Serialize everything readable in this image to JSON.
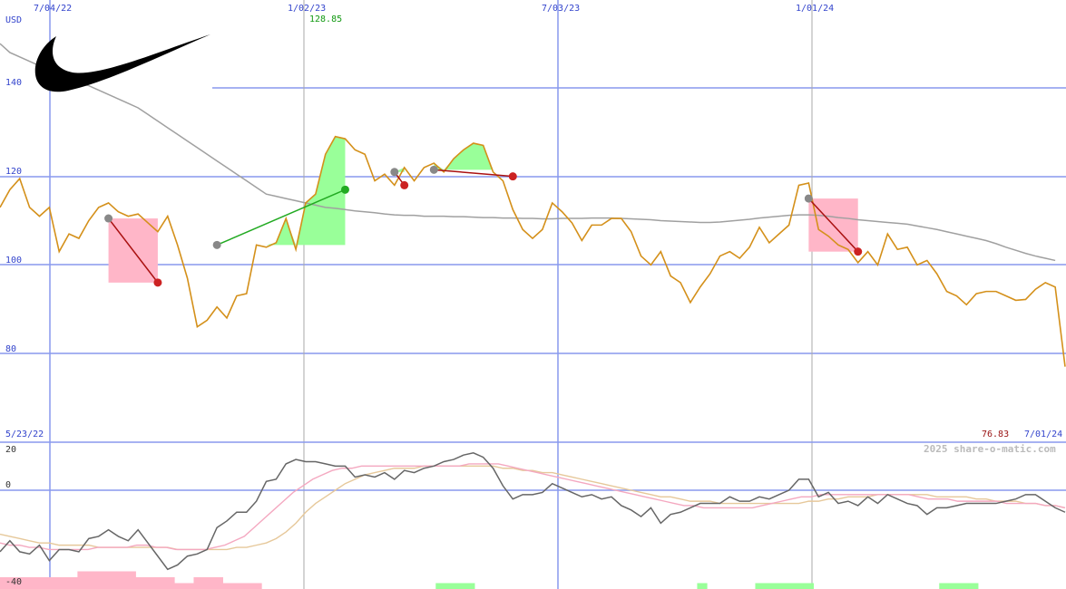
{
  "chart_data": {
    "type": "line",
    "currency_label": "USD",
    "date_ticks": [
      "7/04/22",
      "1/02/23",
      "7/03/23",
      "1/01/24"
    ],
    "start_date_label": "5/23/22",
    "end_date_label": "7/01/24",
    "high_label": "128.85",
    "last_label": "76.83",
    "watermark": "2025 share-o-matic.com",
    "price_ticks": [
      80,
      100,
      120,
      140
    ],
    "ylim": [
      68,
      155
    ],
    "oscillator_ticks": [
      "20",
      "0",
      "-40"
    ],
    "oscillator_ylim": [
      -40,
      25
    ],
    "price_series": {
      "name": "",
      "values": [
        113,
        117,
        119.5,
        113,
        111,
        113,
        103,
        107,
        106,
        110,
        113,
        114,
        112,
        111,
        111.5,
        109.5,
        107.5,
        111,
        104.5,
        97,
        86,
        87.5,
        90.5,
        88,
        93,
        93.5,
        104.5,
        104,
        105,
        110.5,
        103.5,
        114,
        116,
        125,
        129,
        128.5,
        126,
        125,
        119,
        120.5,
        118,
        122,
        119,
        122,
        123,
        121,
        124,
        126,
        127.5,
        127,
        121,
        119,
        112.5,
        108,
        106,
        108,
        114,
        112,
        109.5,
        105.5,
        109,
        109,
        110.5,
        110.5,
        107.5,
        102,
        100,
        103,
        97.5,
        96,
        91.5,
        95,
        98,
        102,
        103,
        101.5,
        104,
        108.5,
        105,
        107,
        109,
        118,
        118.5,
        108,
        106.5,
        104.5,
        103.5,
        100.5,
        103,
        100,
        107,
        103.5,
        104,
        100,
        101,
        98,
        94,
        93,
        91,
        93.5,
        94,
        94,
        93,
        92,
        92.2,
        94.5,
        96,
        95,
        77
      ]
    },
    "moving_average": {
      "name": "",
      "values": [
        150,
        148,
        147,
        146,
        145,
        144,
        143,
        142,
        141,
        140.5,
        139.5,
        138.5,
        137.5,
        136.5,
        135.5,
        134,
        132.5,
        131,
        129.5,
        128,
        126.5,
        125,
        123.5,
        122,
        120.5,
        119,
        117.5,
        116,
        115.5,
        115,
        114.5,
        114,
        113.5,
        113,
        112.8,
        112.5,
        112.2,
        112,
        111.8,
        111.5,
        111.3,
        111.2,
        111.2,
        111,
        111,
        111,
        110.9,
        110.9,
        110.8,
        110.7,
        110.7,
        110.6,
        110.6,
        110.5,
        110.5,
        110.4,
        110.4,
        110.5,
        110.5,
        110.5,
        110.6,
        110.6,
        110.6,
        110.5,
        110.4,
        110.3,
        110.2,
        110,
        109.9,
        109.8,
        109.7,
        109.6,
        109.6,
        109.7,
        109.9,
        110.1,
        110.3,
        110.6,
        110.8,
        111,
        111.2,
        111.3,
        111.3,
        111.2,
        111,
        110.7,
        110.5,
        110.2,
        110,
        109.8,
        109.6,
        109.4,
        109.2,
        108.8,
        108.4,
        108,
        107.5,
        107,
        106.5,
        106,
        105.5,
        104.8,
        104,
        103.3,
        102.6,
        102,
        101.5,
        101
      ]
    },
    "buy_signals": [
      {
        "buy_index": 22,
        "buy_value": 104.5,
        "sell_index": 35,
        "sell_value": 117
      },
      {
        "buy_index": 40,
        "buy_value": 121,
        "sell_index": 41,
        "sell_value": 118
      },
      {
        "buy_index": 44,
        "buy_value": 121.5,
        "sell_index": 52,
        "sell_value": 120
      }
    ],
    "sell_signals": [
      {
        "from_index": 11,
        "from_value": 110.5,
        "to_index": 16,
        "to_value": 96
      },
      {
        "from_index": 82,
        "from_value": 115,
        "to_index": 87,
        "to_value": 103
      }
    ],
    "oscillator_series": [
      {
        "name": "",
        "color": "#666666",
        "values": [
          -28,
          -23,
          -28,
          -29,
          -25,
          -32,
          -27,
          -27,
          -28,
          -22,
          -21,
          -18,
          -21,
          -23,
          -18,
          -24,
          -30,
          -36,
          -34,
          -30,
          -29,
          -27,
          -17,
          -14,
          -10,
          -10,
          -5,
          4,
          5,
          12,
          14,
          13,
          13,
          12,
          11,
          11,
          6,
          7,
          6,
          8,
          5,
          9,
          8,
          10,
          11,
          13,
          14,
          16,
          17,
          15,
          10,
          2,
          -4,
          -2,
          -2,
          -1,
          3,
          1,
          -1,
          -3,
          -2,
          -4,
          -3,
          -7,
          -9,
          -12,
          -8,
          -15,
          -11,
          -10,
          -8,
          -6,
          -6,
          -6,
          -3,
          -5,
          -5,
          -3,
          -4,
          -2,
          0,
          5,
          5,
          -3,
          -1,
          -6,
          -5,
          -7,
          -3,
          -6,
          -2,
          -4,
          -6,
          -7,
          -11,
          -8,
          -8,
          -7,
          -6,
          -6,
          -6,
          -6,
          -5,
          -4,
          -2,
          -2,
          -5,
          -8,
          -10
        ]
      },
      {
        "name": "",
        "color": "#f4a8c0",
        "values": [
          -24,
          -25,
          -25,
          -26,
          -26,
          -27,
          -27,
          -27,
          -27,
          -27,
          -26,
          -26,
          -26,
          -26,
          -25,
          -25,
          -26,
          -26,
          -27,
          -27,
          -27,
          -27,
          -26,
          -25,
          -23,
          -21,
          -17,
          -13,
          -9,
          -5,
          -1,
          2,
          5,
          7,
          9,
          10,
          10,
          11,
          11,
          11,
          11,
          11,
          11,
          11,
          11,
          11,
          11,
          11,
          12,
          12,
          12,
          12,
          11,
          10,
          9,
          8,
          7,
          6,
          5,
          4,
          3,
          2,
          1,
          0,
          -1,
          -2,
          -3,
          -4,
          -5,
          -6,
          -7,
          -7,
          -8,
          -8,
          -8,
          -8,
          -8,
          -8,
          -7,
          -6,
          -5,
          -4,
          -3,
          -3,
          -2,
          -2,
          -2,
          -2,
          -2,
          -2,
          -2,
          -2,
          -2,
          -2,
          -3,
          -4,
          -4,
          -4,
          -5,
          -5,
          -5,
          -5,
          -5,
          -6,
          -6,
          -6,
          -6,
          -7,
          -7,
          -8
        ]
      },
      {
        "name": "",
        "color": "#e6c89a",
        "values": [
          -20,
          -21,
          -22,
          -23,
          -24,
          -24,
          -25,
          -25,
          -25,
          -25,
          -26,
          -26,
          -26,
          -26,
          -26,
          -26,
          -26,
          -26,
          -27,
          -27,
          -27,
          -27,
          -27,
          -27,
          -26,
          -26,
          -25,
          -24,
          -22,
          -19,
          -15,
          -10,
          -6,
          -3,
          0,
          3,
          5,
          7,
          8,
          9,
          10,
          10,
          10,
          11,
          11,
          11,
          11,
          11,
          11,
          11,
          11,
          10,
          10,
          9,
          9,
          8,
          8,
          7,
          6,
          5,
          4,
          3,
          2,
          1,
          0,
          -1,
          -2,
          -3,
          -3,
          -4,
          -5,
          -5,
          -5,
          -6,
          -6,
          -6,
          -6,
          -6,
          -6,
          -6,
          -6,
          -6,
          -5,
          -5,
          -4,
          -4,
          -3,
          -3,
          -3,
          -2,
          -2,
          -2,
          -2,
          -2,
          -2,
          -3,
          -3,
          -3,
          -3,
          -4,
          -4,
          -5,
          -5,
          -5,
          -6,
          -6,
          -7,
          -7,
          -8
        ]
      }
    ],
    "volume_bars": {
      "name": "",
      "colors": {
        "up": "#99ff99",
        "down": "#ffb6c8"
      },
      "values": [
        -2,
        -2,
        -2,
        -2,
        -2,
        -2,
        -2,
        -2,
        -3,
        -3,
        -3,
        -3,
        -3,
        -3,
        -2,
        -2,
        -2,
        -2,
        -1,
        -1,
        -2,
        -2,
        -2,
        -1,
        -1,
        -1,
        -1,
        0,
        0,
        0,
        0,
        0,
        0,
        0,
        0,
        0,
        0,
        0,
        0,
        0,
        0,
        0,
        0,
        0,
        0,
        1,
        1,
        1,
        1,
        0,
        0,
        0,
        0,
        0,
        0,
        0,
        0,
        0,
        0,
        0,
        0,
        0,
        0,
        0,
        0,
        0,
        0,
        0,
        0,
        0,
        0,
        0,
        1,
        0,
        0,
        0,
        0,
        0,
        1,
        1,
        1,
        1,
        1,
        1,
        0,
        0,
        0,
        0,
        0,
        0,
        0,
        0,
        0,
        0,
        0,
        0,
        0,
        1,
        1,
        1,
        1,
        0,
        0,
        0,
        0,
        0,
        0,
        0,
        0,
        0
      ]
    },
    "colors": {
      "price": "#d4901a",
      "moving_average": "#a0a0a0",
      "buy_fill": "#99ff99",
      "sell_fill": "#ffb6c8",
      "buy_line": "#22aa22",
      "sell_line": "#aa1111",
      "signal_dot_gray": "#888888",
      "signal_dot_red": "#cc2222",
      "signal_dot_green": "#22aa22",
      "grid": "#8899ee",
      "logo": "#000000"
    },
    "grid": true,
    "logo_icon": "swoosh-icon"
  }
}
